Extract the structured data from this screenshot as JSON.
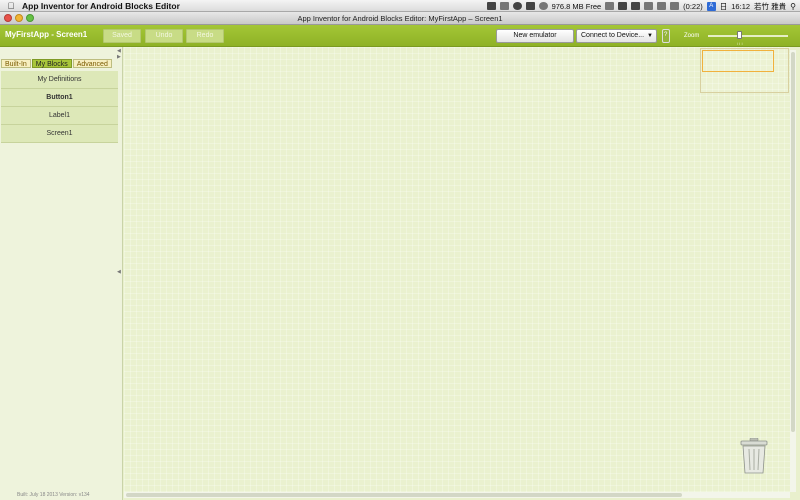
{
  "menubar": {
    "app_name": "App Inventor for Android Blocks Editor",
    "memory": "976.8 MB Free",
    "battery": "(0:22)",
    "input_indicator": "A",
    "day": "日",
    "time": "16:12",
    "user": "若竹 雅貴"
  },
  "window": {
    "title": "App Inventor for Android Blocks Editor: MyFirstApp – Screen1"
  },
  "toolbar": {
    "project_title": "MyFirstApp - Screen1",
    "saved_label": "Saved",
    "undo_label": "Undo",
    "redo_label": "Redo",
    "new_emulator_label": "New emulator",
    "connect_label": "Connect to Device...",
    "zoom_label": "Zoom"
  },
  "sidebar": {
    "tabs": [
      {
        "label": "Built-In",
        "active": false
      },
      {
        "label": "My Blocks",
        "active": true
      },
      {
        "label": "Advanced",
        "active": false
      }
    ],
    "items": [
      {
        "label": "My Definitions",
        "bold": false
      },
      {
        "label": "Button1",
        "bold": true
      },
      {
        "label": "Label1",
        "bold": false
      },
      {
        "label": "Screen1",
        "bold": false
      }
    ],
    "build_info": "Built: July 18 2013 Version: v134"
  },
  "colors": {
    "toolbar_green": "#9bbd2f",
    "workspace_bg": "#eaf1cf",
    "active_tab": "#a8c63a",
    "minimap_view": "#f1b13d"
  }
}
